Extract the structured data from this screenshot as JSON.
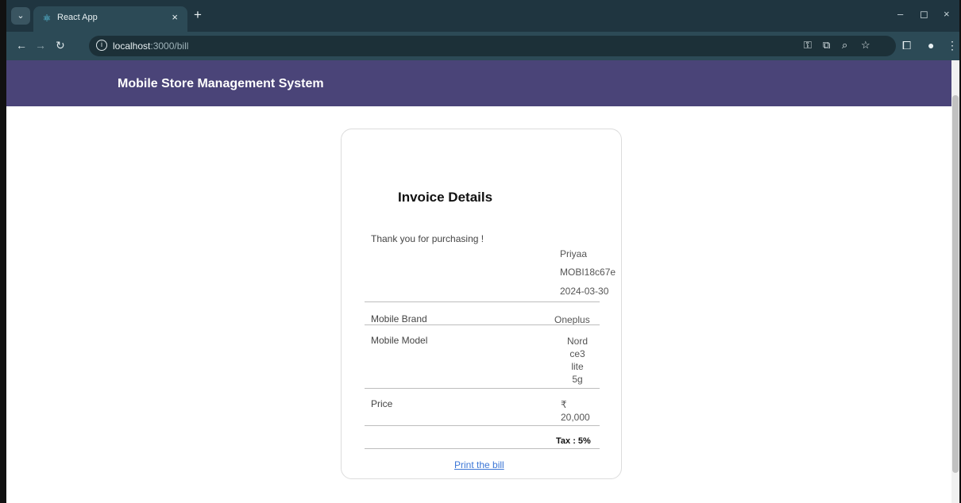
{
  "browser": {
    "tab_title": "React App",
    "tab_close": "×",
    "new_tab": "+",
    "url_host": "localhost",
    "url_path": ":3000/bill",
    "window_controls": [
      "–",
      "◻",
      "×"
    ]
  },
  "app": {
    "title": "Mobile Store Management System",
    "header_color": "#4a4478"
  },
  "invoice": {
    "title": "Invoice Details",
    "thank_you": "Thank you for purchasing !",
    "customer_name": "Priyaa",
    "invoice_id": "MOBI18c67e",
    "date": "2024-03-30",
    "rows": [
      {
        "label": "Mobile Brand",
        "value": "Oneplus"
      },
      {
        "label": "Mobile Model",
        "value_lines": [
          "Nord",
          "ce3",
          "lite",
          "5g"
        ]
      },
      {
        "label": "Price",
        "value_lines": [
          "₹",
          "20,000"
        ]
      }
    ],
    "tax": "Tax : 5%",
    "print_link": "Print the bill",
    "link_color": "#3b76d6"
  }
}
